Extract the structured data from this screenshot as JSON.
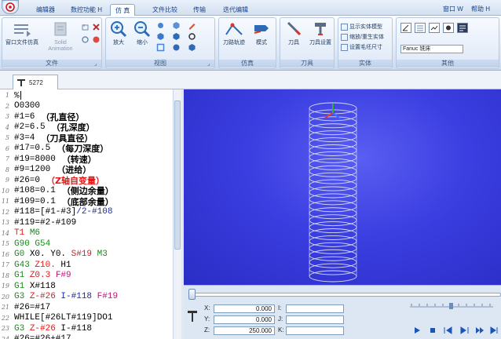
{
  "ribbon_tabs": [
    "编辑器",
    "数控功能 H",
    "仿 真",
    "文件比较",
    "传输",
    "迭代编辑"
  ],
  "active_tab": "仿 真",
  "right_menu": [
    "窗口 W",
    "帮助 H"
  ],
  "groups": {
    "file": {
      "label": "文件",
      "buttons": [
        "窗口文件仿真",
        "Solid Animation"
      ]
    },
    "view": {
      "label": "视图",
      "buttons": [
        "放大",
        "缩小"
      ]
    },
    "sim": {
      "label": "仿真",
      "buttons": [
        "刀路轨迹",
        "模式"
      ]
    },
    "tool": {
      "label": "刀具",
      "buttons": [
        "刀具",
        "刀具设置"
      ]
    },
    "solid": {
      "label": "实体",
      "items": [
        "显示实体模型",
        "缩放/重生实体",
        "设置毛坯尺寸"
      ]
    },
    "other": {
      "label": "其他",
      "combo_value": "Fanuc 铣床"
    }
  },
  "doc_tab": {
    "label": "5272"
  },
  "code_lines": [
    {
      "n": "1",
      "parts": [
        {
          "t": "%",
          "c": "c"
        }
      ],
      "caret": true
    },
    {
      "n": "2",
      "parts": [
        {
          "t": "O0300",
          "c": "c"
        }
      ]
    },
    {
      "n": "3",
      "parts": [
        {
          "t": "#1=6",
          "c": "c"
        }
      ],
      "comment": "（孔直径）"
    },
    {
      "n": "4",
      "parts": [
        {
          "t": "#2=6.5",
          "c": "c"
        }
      ],
      "comment": "（孔深度）"
    },
    {
      "n": "5",
      "parts": [
        {
          "t": "#3=4",
          "c": "c"
        }
      ],
      "comment": "（刀具直径）"
    },
    {
      "n": "6",
      "parts": [
        {
          "t": "#17=0.5",
          "c": "c"
        }
      ],
      "comment": "（每刀深度）"
    },
    {
      "n": "7",
      "parts": [
        {
          "t": "#19=8000",
          "c": "c"
        }
      ],
      "comment": "（转速）"
    },
    {
      "n": "8",
      "parts": [
        {
          "t": "#9=1200",
          "c": "c"
        }
      ],
      "comment": "（进给）"
    },
    {
      "n": "9",
      "parts": [
        {
          "t": "#26=0",
          "c": "c"
        }
      ],
      "comment": "（Z轴自变量）",
      "comment_red": true
    },
    {
      "n": "10",
      "parts": [
        {
          "t": "#108=0.1",
          "c": "c"
        }
      ],
      "comment": "（侧边余量）"
    },
    {
      "n": "11",
      "parts": [
        {
          "t": "#109=0.1",
          "c": "c"
        }
      ],
      "comment": "（底部余量）"
    },
    {
      "n": "12",
      "parts": [
        {
          "t": "#118=[#1-#3]",
          "c": "c"
        },
        {
          "t": "/2-#108",
          "c": "b"
        }
      ]
    },
    {
      "n": "13",
      "parts": [
        {
          "t": "#119=#2-#109",
          "c": "c"
        }
      ]
    },
    {
      "n": "14",
      "parts": [
        {
          "t": "T1 ",
          "c": "r"
        },
        {
          "t": "M6",
          "c": "g"
        }
      ]
    },
    {
      "n": "15",
      "parts": [
        {
          "t": "G90 G54",
          "c": "g"
        }
      ]
    },
    {
      "n": "16",
      "parts": [
        {
          "t": "G0 ",
          "c": "g"
        },
        {
          "t": "X0. Y0. ",
          "c": "c"
        },
        {
          "t": "S#19 ",
          "c": "r"
        },
        {
          "t": "M3",
          "c": "g"
        }
      ]
    },
    {
      "n": "17",
      "parts": [
        {
          "t": "G43 ",
          "c": "g"
        },
        {
          "t": "Z10. ",
          "c": "r"
        },
        {
          "t": "H1",
          "c": "c"
        }
      ]
    },
    {
      "n": "18",
      "parts": [
        {
          "t": "G1 ",
          "c": "g"
        },
        {
          "t": "Z0.3 ",
          "c": "r"
        },
        {
          "t": "F#9",
          "c": "m"
        }
      ]
    },
    {
      "n": "19",
      "parts": [
        {
          "t": "G1 ",
          "c": "g"
        },
        {
          "t": "X#118",
          "c": "c"
        }
      ]
    },
    {
      "n": "20",
      "parts": [
        {
          "t": "G3 ",
          "c": "g"
        },
        {
          "t": "Z-#26 ",
          "c": "r"
        },
        {
          "t": "I-#118 ",
          "c": "b"
        },
        {
          "t": "F#19",
          "c": "m"
        }
      ]
    },
    {
      "n": "21",
      "parts": [
        {
          "t": "#26=#17",
          "c": "c"
        }
      ]
    },
    {
      "n": "22",
      "parts": [
        {
          "t": "WHILE[#26LT#119]DO1",
          "c": "c"
        }
      ]
    },
    {
      "n": "23",
      "parts": [
        {
          "t": "G3 ",
          "c": "g"
        },
        {
          "t": "Z-#26 ",
          "c": "r"
        },
        {
          "t": "I-#118",
          "c": "c"
        }
      ]
    },
    {
      "n": "24",
      "parts": [
        {
          "t": "#26=#26+#17",
          "c": "c"
        }
      ]
    }
  ],
  "coords": {
    "x_label": "X:",
    "x_value": "0.000",
    "y_label": "Y:",
    "y_value": "0.000",
    "z_label": "Z:",
    "z_value": "250.000",
    "i_label": "I:",
    "j_label": "J:",
    "k_label": "K:"
  },
  "colors": {
    "viewport_bg": "#3b3ee0",
    "helix": "#d8dcef",
    "ribbon_text": "#15428b"
  }
}
